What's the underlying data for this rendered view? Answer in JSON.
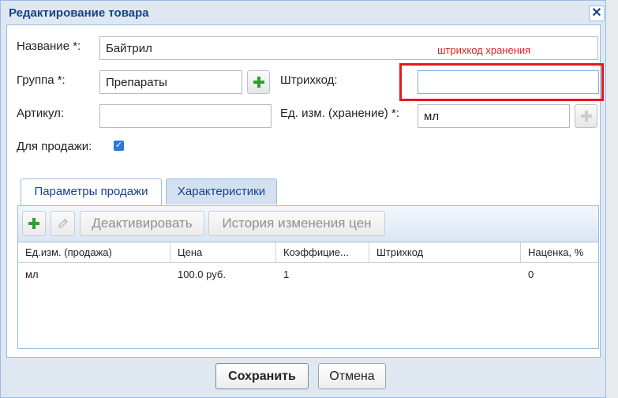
{
  "dialog": {
    "title": "Редактирование товара",
    "close_symbol": "✕"
  },
  "form": {
    "name_label": "Название *:",
    "name_value": "Байтрил",
    "group_label": "Группа *:",
    "group_value": "Препараты",
    "barcode_label": "Штрихкод:",
    "barcode_value": "",
    "article_label": "Артикул:",
    "article_value": "",
    "unit_label": "Ед. изм. (хранение) *:",
    "unit_value": "мл",
    "for_sale_label": "Для продажи:",
    "for_sale_checked": true
  },
  "annotation": {
    "text": "штрихкод хранения",
    "color": "#e3191b"
  },
  "tabs": [
    {
      "label": "Параметры продажи",
      "active": true
    },
    {
      "label": "Характеристики",
      "active": false
    }
  ],
  "toolbar": {
    "add_icon": "plus-icon",
    "edit_icon": "pencil-icon",
    "deactivate_label": "Деактивировать",
    "price_history_label": "История изменения цен"
  },
  "grid": {
    "columns": [
      "Ед.изм. (продажа)",
      "Цена",
      "Коэффицие...",
      "Штрихкод",
      "Наценка, %"
    ],
    "rows": [
      {
        "unit": "мл",
        "price": "100.0 руб.",
        "coefficient": "1",
        "barcode": "",
        "markup": "0"
      }
    ]
  },
  "footer": {
    "save_label": "Сохранить",
    "cancel_label": "Отмена"
  },
  "colors": {
    "accent_green": "#2ea02e",
    "title_blue": "#15428b",
    "checkbox_blue": "#2b78d6"
  }
}
